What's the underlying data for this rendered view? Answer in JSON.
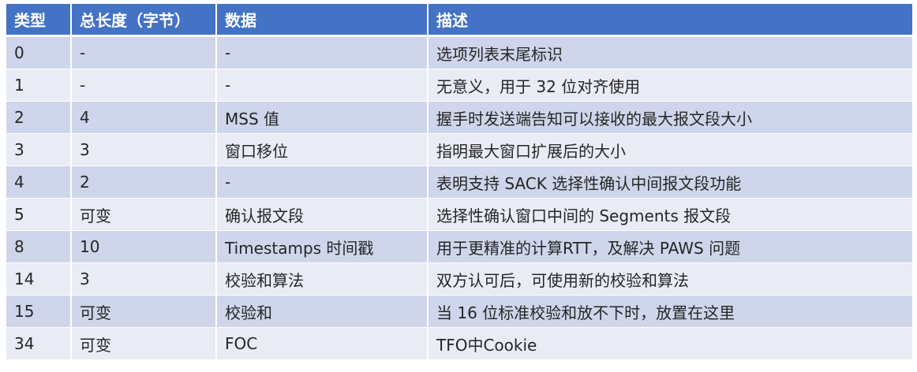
{
  "table": {
    "headers": [
      "类型",
      "总长度（字节）",
      "数据",
      "描述"
    ],
    "rows": [
      [
        "0",
        "-",
        "-",
        "选项列表末尾标识"
      ],
      [
        "1",
        "-",
        "-",
        "无意义，用于 32 位对齐使用"
      ],
      [
        "2",
        "4",
        "MSS 值",
        "握手时发送端告知可以接收的最大报文段大小"
      ],
      [
        "3",
        "3",
        "窗口移位",
        "指明最大窗口扩展后的大小"
      ],
      [
        "4",
        "2",
        "-",
        "表明支持 SACK 选择性确认中间报文段功能"
      ],
      [
        "5",
        "可变",
        "确认报文段",
        "选择性确认窗口中间的 Segments 报文段"
      ],
      [
        "8",
        "10",
        "Timestamps 时间戳",
        "用于更精准的计算RTT，及解决 PAWS 问题"
      ],
      [
        "14",
        "3",
        "校验和算法",
        "双方认可后，可使用新的校验和算法"
      ],
      [
        "15",
        "可变",
        "校验和",
        "当 16 位标准校验和放不下时，放置在这里"
      ],
      [
        "34",
        "可变",
        "FOC",
        "TFO中Cookie"
      ]
    ]
  },
  "colors": {
    "header_bg": "#4472c4",
    "header_text": "#ffffff",
    "row_odd_bg": "#cfd5ea",
    "row_even_bg": "#e9ebf5",
    "cell_text": "#262626"
  }
}
